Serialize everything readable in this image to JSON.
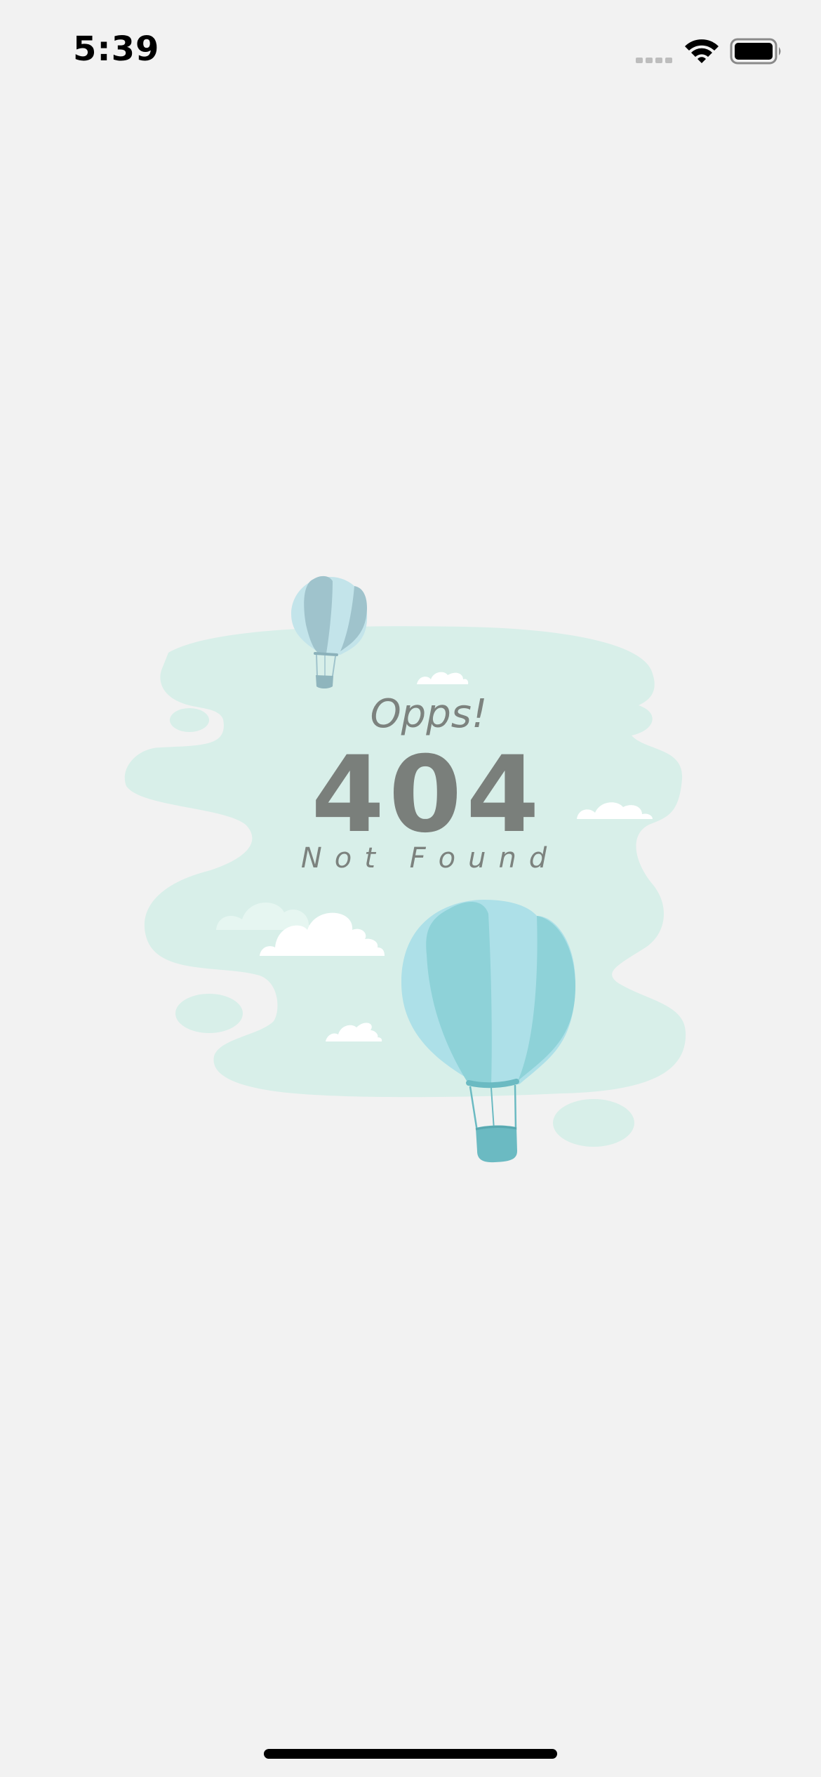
{
  "status_bar": {
    "time": "5:39",
    "signal_icon": "cellular-signal-icon",
    "wifi_icon": "wifi-icon",
    "battery_icon": "battery-icon"
  },
  "error_page": {
    "exclamation": "Opps!",
    "code": "404",
    "message": "Not Found"
  },
  "colors": {
    "background": "#f2f2f2",
    "blob": "#d8efe9",
    "text": "#7a807c",
    "balloon_small_dark": "#9fc3cc",
    "balloon_small_light": "#c3e4ea",
    "balloon_large_dark": "#8ed2d8",
    "balloon_large_light": "#ade0e8",
    "basket": "#6bbac2"
  }
}
